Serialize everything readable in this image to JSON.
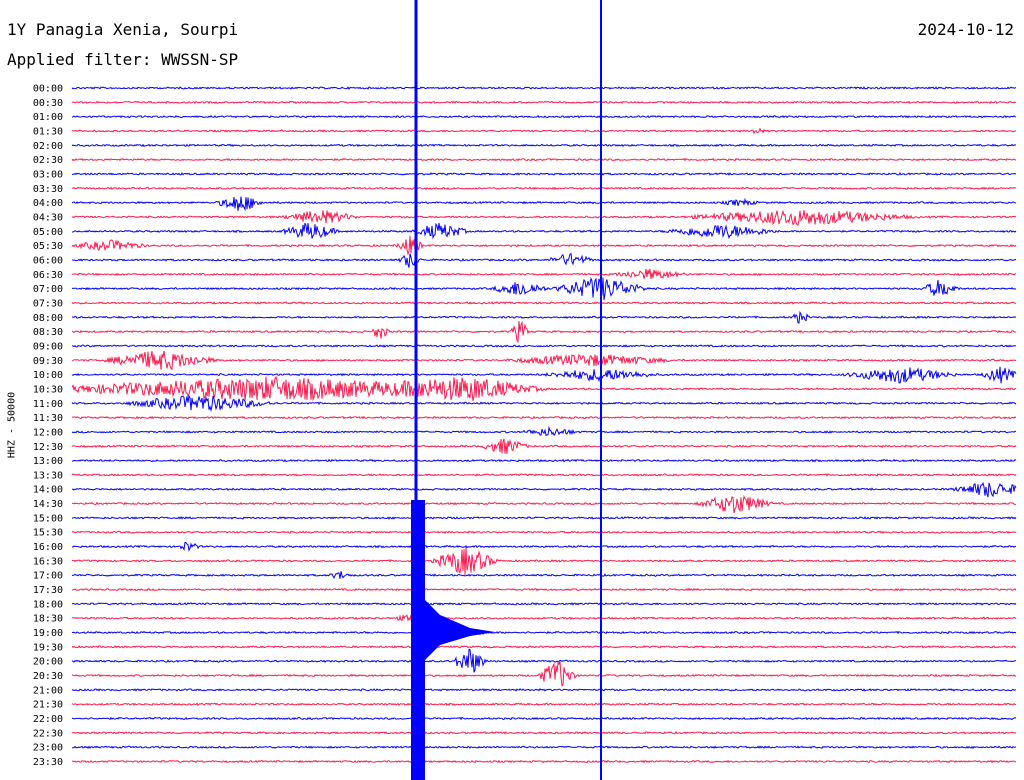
{
  "header": {
    "station": "1Y Panagia Xenia, Sourpi",
    "date": "2024-10-12",
    "filter": "Applied filter: WWSSN-SP"
  },
  "ylabel": "HHZ - 50000",
  "chart_data": {
    "type": "line",
    "title": "1Y Panagia Xenia, Sourpi",
    "subtitle": "Applied filter: WWSSN-SP",
    "date": "2024-10-12",
    "ylabel": "HHZ - 50000",
    "trace_labels": [
      "00:00",
      "00:30",
      "01:00",
      "01:30",
      "02:00",
      "02:30",
      "03:00",
      "03:30",
      "04:00",
      "04:30",
      "05:00",
      "05:30",
      "06:00",
      "06:30",
      "07:00",
      "07:30",
      "08:00",
      "08:30",
      "09:00",
      "09:30",
      "10:00",
      "10:30",
      "11:00",
      "11:30",
      "12:00",
      "12:30",
      "13:00",
      "13:30",
      "14:00",
      "14:30",
      "15:00",
      "15:30",
      "16:00",
      "16:30",
      "17:00",
      "17:30",
      "18:00",
      "18:30",
      "19:00",
      "19:30",
      "20:00",
      "20:30",
      "21:00",
      "21:30",
      "22:00",
      "22:30",
      "23:00",
      "23:30"
    ],
    "colors": {
      "even": "#0000ff",
      "odd": "#ff1a4b",
      "label": "#000000"
    },
    "grid": false
  }
}
